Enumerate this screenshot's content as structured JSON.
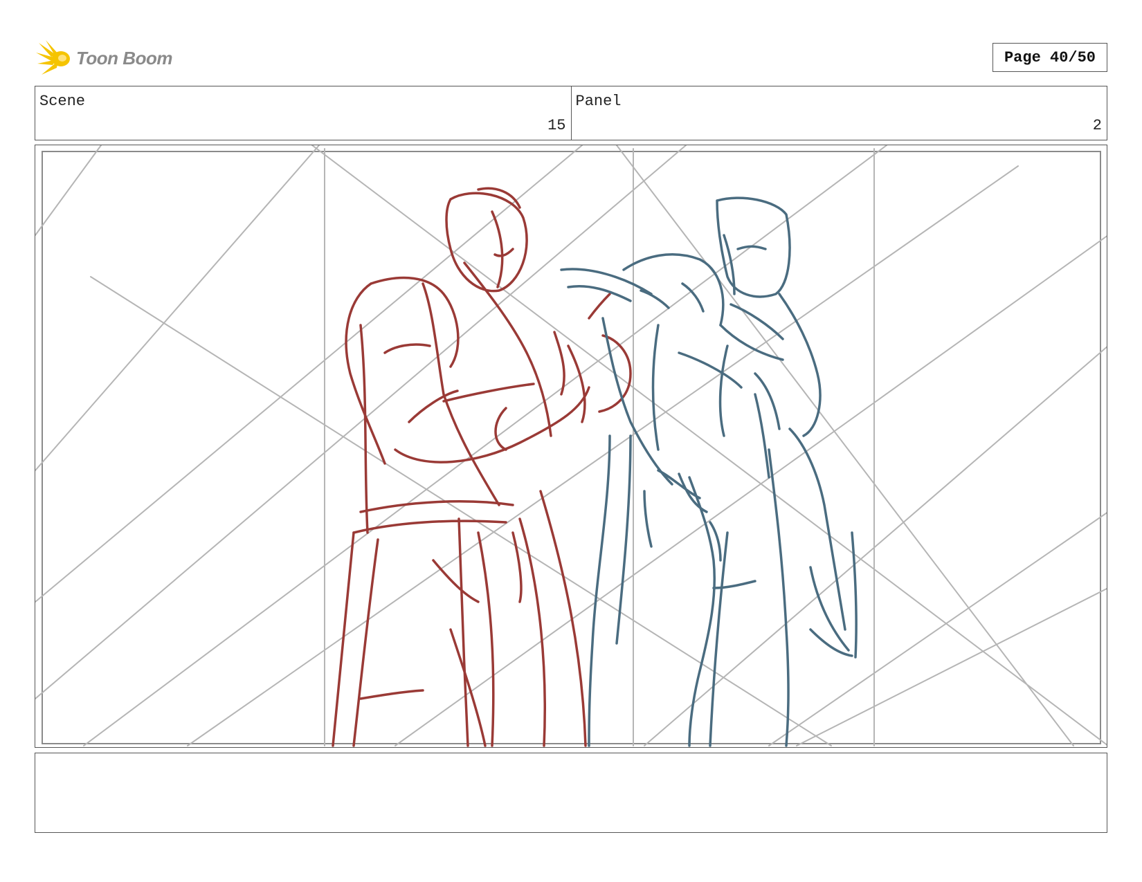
{
  "logo": {
    "text": "Toon Boom",
    "icon": "burst-icon",
    "color": "#f5c400"
  },
  "page_indicator": "Page 40/50",
  "scene": {
    "label": "Scene",
    "value": "15"
  },
  "panel": {
    "label": "Panel",
    "value": "2"
  },
  "sketch": {
    "left_figure_color": "#9a3a36",
    "right_figure_color": "#4a6c80",
    "guide_color": "#b5b5b5"
  },
  "notes": {
    "text": ""
  }
}
